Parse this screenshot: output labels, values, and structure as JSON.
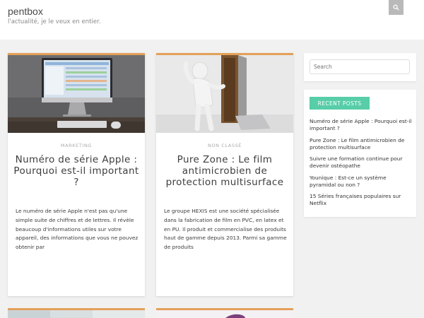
{
  "site": {
    "title": "pentbox",
    "tagline": "l'actualité, je le veux en entier."
  },
  "search": {
    "placeholder": "Search",
    "icon": "search-icon"
  },
  "posts": [
    {
      "category": "MARKETING",
      "title": "Numéro de série Apple : Pourquoi est-il important ?",
      "excerpt": "Le numéro de série Apple n'est pas qu'une simple suite de chiffres et de lettres. Il révèle beaucoup d'informations utiles sur votre appareil, des informations que vous ne pouvez obtenir par"
    },
    {
      "category": "NON CLASSÉ",
      "title": "Pure Zone : Le film antimicrobien de protection multisurface",
      "excerpt": "Le groupe HEXIS est une société spécialisée dans la fabrication de film en PVC, en latex et en PU. Il produit et commercialise des produits haut de gamme depuis 2013. Parmi sa gamme de produits"
    }
  ],
  "recent_posts": {
    "title": "RECENT POSTS",
    "items": [
      "Numéro de série Apple : Pourquoi est-il important ?",
      "Pure Zone : Le film antimicrobien de protection multisurface",
      "Suivre une formation continue pour devenir ostéopathe",
      "Younique : Est-ce un système pyramidal ou non ?",
      "15 Séries françaises populaires sur Netflix"
    ]
  },
  "colors": {
    "accent_border": "#e4a15a",
    "widget_title_bg": "#57cda8",
    "background": "#f1f1f1"
  }
}
